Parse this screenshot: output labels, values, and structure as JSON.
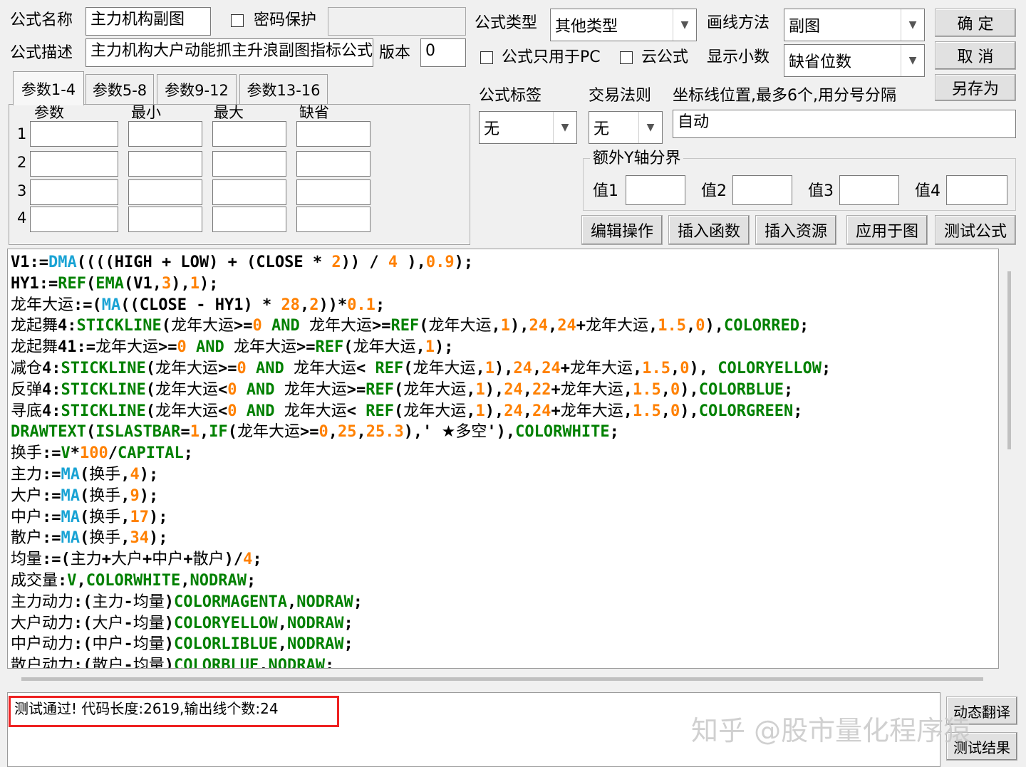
{
  "header": {
    "formula_name_label": "公式名称",
    "formula_name_value": "主力机构副图",
    "password_label": "密码保护",
    "formula_desc_label": "公式描述",
    "formula_desc_value": "主力机构大户动能抓主升浪副图指标公式",
    "version_label": "版本",
    "version_value": "0",
    "formula_type_label": "公式类型",
    "formula_type_value": "其他类型",
    "draw_method_label": "画线方法",
    "draw_method_value": "副图",
    "pc_only_label": "公式只用于PC",
    "cloud_label": "云公式",
    "decimals_label": "显示小数",
    "decimals_value": "缺省位数",
    "formula_tag_label": "公式标签",
    "formula_tag_value": "无",
    "trade_rule_label": "交易法则",
    "trade_rule_value": "无",
    "axis_label": "坐标线位置,最多6个,用分号分隔",
    "axis_value": "自动",
    "extra_y_label": "额外Y轴分界",
    "v1": "值1",
    "v2": "值2",
    "v3": "值3",
    "v4": "值4"
  },
  "buttons": {
    "ok": "确  定",
    "cancel": "取  消",
    "save_as": "另存为",
    "edit_ops": "编辑操作",
    "insert_func": "插入函数",
    "insert_res": "插入资源",
    "apply_chart": "应用于图",
    "test_formula": "测试公式",
    "dyn_translate": "动态翻译",
    "test_result": "测试结果"
  },
  "tabs": [
    "参数1-4",
    "参数5-8",
    "参数9-12",
    "参数13-16"
  ],
  "params": {
    "headers": [
      "参数",
      "最小",
      "最大",
      "缺省"
    ],
    "rows": [
      "1",
      "2",
      "3",
      "4"
    ]
  },
  "code_lines": [
    [
      [
        "k",
        "V1:="
      ],
      [
        "f",
        "DMA"
      ],
      [
        "o",
        "((((HIGH + LOW) + (CLOSE * "
      ],
      [
        "n",
        "2"
      ],
      [
        "o",
        ")) / "
      ],
      [
        "n",
        "4"
      ],
      [
        "o",
        " ),"
      ],
      [
        "n",
        "0.9"
      ],
      [
        "o",
        ");"
      ]
    ],
    [
      [
        "k",
        "HY1:="
      ],
      [
        "g",
        "REF"
      ],
      [
        "o",
        "("
      ],
      [
        "g",
        "EMA"
      ],
      [
        "o",
        "(V1,"
      ],
      [
        "n",
        "3"
      ],
      [
        "o",
        "),"
      ],
      [
        "n",
        "1"
      ],
      [
        "o",
        ");"
      ]
    ],
    [
      [
        "c",
        "龙年大运"
      ],
      [
        "k",
        ":=("
      ],
      [
        "f",
        "MA"
      ],
      [
        "o",
        "((CLOSE - HY1) * "
      ],
      [
        "n",
        "28"
      ],
      [
        "o",
        ","
      ],
      [
        "n",
        "2"
      ],
      [
        "o",
        "))*"
      ],
      [
        "n",
        "0.1"
      ],
      [
        "o",
        ";"
      ]
    ],
    [
      [
        "c",
        "龙起舞"
      ],
      [
        "k",
        "4:"
      ],
      [
        "g",
        "STICKLINE"
      ],
      [
        "o",
        "("
      ],
      [
        "c",
        "龙年大运"
      ],
      [
        "o",
        ">="
      ],
      [
        "n",
        "0"
      ],
      [
        "g",
        " AND "
      ],
      [
        "c",
        "龙年大运"
      ],
      [
        "o",
        ">="
      ],
      [
        "g",
        "REF"
      ],
      [
        "o",
        "("
      ],
      [
        "c",
        "龙年大运"
      ],
      [
        "o",
        ","
      ],
      [
        "n",
        "1"
      ],
      [
        "o",
        "),"
      ],
      [
        "n",
        "24"
      ],
      [
        "o",
        ","
      ],
      [
        "n",
        "24"
      ],
      [
        "o",
        "+"
      ],
      [
        "c",
        "龙年大运"
      ],
      [
        "o",
        ","
      ],
      [
        "n",
        "1.5"
      ],
      [
        "o",
        ","
      ],
      [
        "n",
        "0"
      ],
      [
        "o",
        "),"
      ],
      [
        "g",
        "COLORRED"
      ],
      [
        "o",
        ";"
      ]
    ],
    [
      [
        "c",
        "龙起舞"
      ],
      [
        "k",
        "41:="
      ],
      [
        "c",
        "龙年大运"
      ],
      [
        "o",
        ">="
      ],
      [
        "n",
        "0"
      ],
      [
        "g",
        " AND "
      ],
      [
        "c",
        "龙年大运"
      ],
      [
        "o",
        ">="
      ],
      [
        "g",
        "REF"
      ],
      [
        "o",
        "("
      ],
      [
        "c",
        "龙年大运"
      ],
      [
        "o",
        ","
      ],
      [
        "n",
        "1"
      ],
      [
        "o",
        ");"
      ]
    ],
    [
      [
        "c",
        "减仓"
      ],
      [
        "k",
        "4:"
      ],
      [
        "g",
        "STICKLINE"
      ],
      [
        "o",
        "("
      ],
      [
        "c",
        "龙年大运"
      ],
      [
        "o",
        ">="
      ],
      [
        "n",
        "0"
      ],
      [
        "g",
        " AND "
      ],
      [
        "c",
        "龙年大运"
      ],
      [
        "o",
        "< "
      ],
      [
        "g",
        "REF"
      ],
      [
        "o",
        "("
      ],
      [
        "c",
        "龙年大运"
      ],
      [
        "o",
        ","
      ],
      [
        "n",
        "1"
      ],
      [
        "o",
        "),"
      ],
      [
        "n",
        "24"
      ],
      [
        "o",
        ","
      ],
      [
        "n",
        "24"
      ],
      [
        "o",
        "+"
      ],
      [
        "c",
        "龙年大运"
      ],
      [
        "o",
        ","
      ],
      [
        "n",
        "1.5"
      ],
      [
        "o",
        ","
      ],
      [
        "n",
        "0"
      ],
      [
        "o",
        "), "
      ],
      [
        "g",
        "COLORYELLOW"
      ],
      [
        "o",
        ";"
      ]
    ],
    [
      [
        "c",
        "反弹"
      ],
      [
        "k",
        "4:"
      ],
      [
        "g",
        "STICKLINE"
      ],
      [
        "o",
        "("
      ],
      [
        "c",
        "龙年大运"
      ],
      [
        "o",
        "<"
      ],
      [
        "n",
        "0"
      ],
      [
        "g",
        " AND "
      ],
      [
        "c",
        "龙年大运"
      ],
      [
        "o",
        ">="
      ],
      [
        "g",
        "REF"
      ],
      [
        "o",
        "("
      ],
      [
        "c",
        "龙年大运"
      ],
      [
        "o",
        ","
      ],
      [
        "n",
        "1"
      ],
      [
        "o",
        "),"
      ],
      [
        "n",
        "24"
      ],
      [
        "o",
        ","
      ],
      [
        "n",
        "22"
      ],
      [
        "o",
        "+"
      ],
      [
        "c",
        "龙年大运"
      ],
      [
        "o",
        ","
      ],
      [
        "n",
        "1.5"
      ],
      [
        "o",
        ","
      ],
      [
        "n",
        "0"
      ],
      [
        "o",
        "),"
      ],
      [
        "g",
        "COLORBLUE"
      ],
      [
        "o",
        ";"
      ]
    ],
    [
      [
        "c",
        "寻底"
      ],
      [
        "k",
        "4:"
      ],
      [
        "g",
        "STICKLINE"
      ],
      [
        "o",
        "("
      ],
      [
        "c",
        "龙年大运"
      ],
      [
        "o",
        "<"
      ],
      [
        "n",
        "0"
      ],
      [
        "g",
        " AND "
      ],
      [
        "c",
        "龙年大运"
      ],
      [
        "o",
        "< "
      ],
      [
        "g",
        "REF"
      ],
      [
        "o",
        "("
      ],
      [
        "c",
        "龙年大运"
      ],
      [
        "o",
        ","
      ],
      [
        "n",
        "1"
      ],
      [
        "o",
        "),"
      ],
      [
        "n",
        "24"
      ],
      [
        "o",
        ","
      ],
      [
        "n",
        "24"
      ],
      [
        "o",
        "+"
      ],
      [
        "c",
        "龙年大运"
      ],
      [
        "o",
        ","
      ],
      [
        "n",
        "1.5"
      ],
      [
        "o",
        ","
      ],
      [
        "n",
        "0"
      ],
      [
        "o",
        "),"
      ],
      [
        "g",
        "COLORGREEN"
      ],
      [
        "o",
        ";"
      ]
    ],
    [
      [
        "g",
        "DRAWTEXT"
      ],
      [
        "o",
        "("
      ],
      [
        "g",
        "ISLASTBAR"
      ],
      [
        "o",
        "="
      ],
      [
        "n",
        "1"
      ],
      [
        "o",
        ","
      ],
      [
        "g",
        "IF"
      ],
      [
        "o",
        "("
      ],
      [
        "c",
        "龙年大运"
      ],
      [
        "o",
        ">="
      ],
      [
        "n",
        "0"
      ],
      [
        "o",
        ","
      ],
      [
        "n",
        "25"
      ],
      [
        "o",
        ","
      ],
      [
        "n",
        "25.3"
      ],
      [
        "o",
        "),' "
      ],
      [
        "c",
        "★多空"
      ],
      [
        "o",
        "'),"
      ],
      [
        "g",
        "COLORWHITE"
      ],
      [
        "o",
        ";"
      ]
    ],
    [
      [
        "c",
        "换手"
      ],
      [
        "k",
        ":="
      ],
      [
        "g",
        "V"
      ],
      [
        "o",
        "*"
      ],
      [
        "n",
        "100"
      ],
      [
        "o",
        "/"
      ],
      [
        "g",
        "CAPITAL"
      ],
      [
        "o",
        ";"
      ]
    ],
    [
      [
        "c",
        "主力"
      ],
      [
        "k",
        ":="
      ],
      [
        "f",
        "MA"
      ],
      [
        "o",
        "("
      ],
      [
        "c",
        "换手"
      ],
      [
        "o",
        ","
      ],
      [
        "n",
        "4"
      ],
      [
        "o",
        ");"
      ]
    ],
    [
      [
        "c",
        "大户"
      ],
      [
        "k",
        ":="
      ],
      [
        "f",
        "MA"
      ],
      [
        "o",
        "("
      ],
      [
        "c",
        "换手"
      ],
      [
        "o",
        ","
      ],
      [
        "n",
        "9"
      ],
      [
        "o",
        ");"
      ]
    ],
    [
      [
        "c",
        "中户"
      ],
      [
        "k",
        ":="
      ],
      [
        "f",
        "MA"
      ],
      [
        "o",
        "("
      ],
      [
        "c",
        "换手"
      ],
      [
        "o",
        ","
      ],
      [
        "n",
        "17"
      ],
      [
        "o",
        ");"
      ]
    ],
    [
      [
        "c",
        "散户"
      ],
      [
        "k",
        ":="
      ],
      [
        "f",
        "MA"
      ],
      [
        "o",
        "("
      ],
      [
        "c",
        "换手"
      ],
      [
        "o",
        ","
      ],
      [
        "n",
        "34"
      ],
      [
        "o",
        ");"
      ]
    ],
    [
      [
        "c",
        "均量"
      ],
      [
        "k",
        ":=("
      ],
      [
        "c",
        "主力"
      ],
      [
        "o",
        "+"
      ],
      [
        "c",
        "大户"
      ],
      [
        "o",
        "+"
      ],
      [
        "c",
        "中户"
      ],
      [
        "o",
        "+"
      ],
      [
        "c",
        "散户"
      ],
      [
        "o",
        ")/"
      ],
      [
        "n",
        "4"
      ],
      [
        "o",
        ";"
      ]
    ],
    [
      [
        "c",
        "成交量"
      ],
      [
        "k",
        ":"
      ],
      [
        "g",
        "V"
      ],
      [
        "o",
        ","
      ],
      [
        "g",
        "COLORWHITE"
      ],
      [
        "o",
        ","
      ],
      [
        "g",
        "NODRAW"
      ],
      [
        "o",
        ";"
      ]
    ],
    [
      [
        "c",
        "主力动力"
      ],
      [
        "k",
        ":("
      ],
      [
        "c",
        "主力"
      ],
      [
        "o",
        "-"
      ],
      [
        "c",
        "均量"
      ],
      [
        "o",
        ")"
      ],
      [
        "g",
        "COLORMAGENTA"
      ],
      [
        "o",
        ","
      ],
      [
        "g",
        "NODRAW"
      ],
      [
        "o",
        ";"
      ]
    ],
    [
      [
        "c",
        "大户动力"
      ],
      [
        "k",
        ":("
      ],
      [
        "c",
        "大户"
      ],
      [
        "o",
        "-"
      ],
      [
        "c",
        "均量"
      ],
      [
        "o",
        ")"
      ],
      [
        "g",
        "COLORYELLOW"
      ],
      [
        "o",
        ","
      ],
      [
        "g",
        "NODRAW"
      ],
      [
        "o",
        ";"
      ]
    ],
    [
      [
        "c",
        "中户动力"
      ],
      [
        "k",
        ":("
      ],
      [
        "c",
        "中户"
      ],
      [
        "o",
        "-"
      ],
      [
        "c",
        "均量"
      ],
      [
        "o",
        ")"
      ],
      [
        "g",
        "COLORLIBLUE"
      ],
      [
        "o",
        ","
      ],
      [
        "g",
        "NODRAW"
      ],
      [
        "o",
        ";"
      ]
    ],
    [
      [
        "c",
        "散户动力"
      ],
      [
        "k",
        ":("
      ],
      [
        "c",
        "散户"
      ],
      [
        "o",
        "-"
      ],
      [
        "c",
        "均量"
      ],
      [
        "o",
        ")"
      ],
      [
        "g",
        "COLORBLUE"
      ],
      [
        "o",
        "."
      ],
      [
        "g",
        "NODRAW"
      ],
      [
        "o",
        ":"
      ]
    ]
  ],
  "message": "测试通过! 代码长度:2619,输出线个数:24",
  "watermark": "知乎 @股市量化程序猿",
  "colors": {
    "func_blue": "#1aa3d4",
    "keyword_green": "#008000",
    "number_orange": "#ff8000",
    "highlight_red": "#e22222"
  }
}
